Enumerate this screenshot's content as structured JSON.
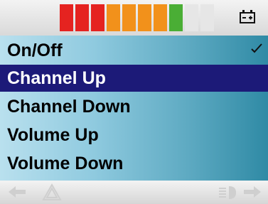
{
  "status": {
    "battery_segments": [
      {
        "color": "#e52320"
      },
      {
        "color": "#e52320"
      },
      {
        "color": "#e52320"
      },
      {
        "color": "#f2911b"
      },
      {
        "color": "#f2911b"
      },
      {
        "color": "#f2911b"
      },
      {
        "color": "#f2911b"
      },
      {
        "color": "#4aae35"
      },
      {
        "color": "#e6e6e6"
      },
      {
        "color": "#e6e6e6"
      }
    ],
    "battery_icon": "battery-icon"
  },
  "menu": {
    "items": [
      {
        "label": "On/Off",
        "checked": true
      },
      {
        "label": "Channel Up",
        "selected": true
      },
      {
        "label": "Channel Down"
      },
      {
        "label": "Volume Up"
      },
      {
        "label": "Volume Down"
      }
    ]
  },
  "bottom": {
    "icons": [
      "back-arrow-icon",
      "warning-icon",
      "lights-icon",
      "forward-arrow-icon"
    ]
  },
  "colors": {
    "selection": "#1c1a78",
    "panel_gradient_start": "#b9e0ee",
    "panel_gradient_end": "#2f8aa5"
  }
}
